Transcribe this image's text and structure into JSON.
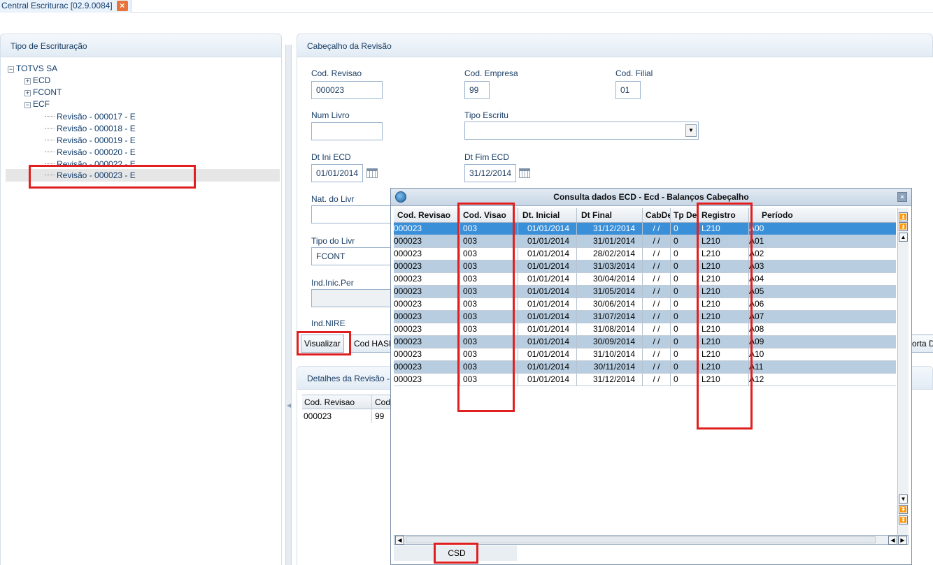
{
  "tab": {
    "title": "Central Escriturac [02.9.0084]",
    "close": "×"
  },
  "left_panel": {
    "title": "Tipo de Escrituração",
    "tree": {
      "root": "TOTVS SA",
      "ecd": "ECD",
      "fcont": "FCONT",
      "ecf": "ECF",
      "revisions": [
        "Revisão - 000017 - E",
        "Revisão - 000018 - E",
        "Revisão - 000019 - E",
        "Revisão - 000020 - E",
        "Revisão - 000022 - E",
        "Revisão - 000023 - E"
      ]
    }
  },
  "header_panel": {
    "title": "Cabeçalho da Revisão",
    "cod_revisao": {
      "label": "Cod. Revisao",
      "value": "000023"
    },
    "cod_empresa": {
      "label": "Cod. Empresa",
      "value": "99"
    },
    "cod_filial": {
      "label": "Cod. Filial",
      "value": "01"
    },
    "num_livro": {
      "label": "Num Livro",
      "value": ""
    },
    "tipo_escritu": {
      "label": "Tipo Escritu",
      "value": ""
    },
    "dt_ini": {
      "label": "Dt Ini ECD",
      "value": "01/01/2014"
    },
    "dt_fim": {
      "label": "Dt Fim ECD",
      "value": "31/12/2014"
    },
    "nat_livro": {
      "label": "Nat. do Livr",
      "value": ""
    },
    "tipo_livro": {
      "label": "Tipo do Livr",
      "value": "FCONT"
    },
    "ind_inic": {
      "label": "Ind.Inic.Per",
      "value": ""
    },
    "ind_nire": {
      "label": "Ind.NIRE"
    },
    "visualizar": "Visualizar",
    "cod_hash": "Cod HASH",
    "porta": "orta D"
  },
  "details_panel": {
    "title": "Detalhes da Revisão -",
    "columns": [
      "Cod. Revisao",
      "Cod"
    ],
    "rows": [
      [
        "000023",
        "99"
      ]
    ]
  },
  "dialog": {
    "title": "Consulta dados ECD - Ecd - Balanços Cabeçalho",
    "close": "×",
    "columns": [
      "Cod. Revisao",
      "Cod. Visao",
      "Dt. Inicial",
      "Dt Final",
      "CabDe",
      "Tp De",
      "Registro",
      "Período"
    ],
    "rows": [
      [
        "000023",
        "003",
        "01/01/2014",
        "31/12/2014",
        "/ /",
        "0",
        "L210",
        "A00"
      ],
      [
        "000023",
        "003",
        "01/01/2014",
        "31/01/2014",
        "/ /",
        "0",
        "L210",
        "A01"
      ],
      [
        "000023",
        "003",
        "01/01/2014",
        "28/02/2014",
        "/ /",
        "0",
        "L210",
        "A02"
      ],
      [
        "000023",
        "003",
        "01/01/2014",
        "31/03/2014",
        "/ /",
        "0",
        "L210",
        "A03"
      ],
      [
        "000023",
        "003",
        "01/01/2014",
        "30/04/2014",
        "/ /",
        "0",
        "L210",
        "A04"
      ],
      [
        "000023",
        "003",
        "01/01/2014",
        "31/05/2014",
        "/ /",
        "0",
        "L210",
        "A05"
      ],
      [
        "000023",
        "003",
        "01/01/2014",
        "30/06/2014",
        "/ /",
        "0",
        "L210",
        "A06"
      ],
      [
        "000023",
        "003",
        "01/01/2014",
        "31/07/2014",
        "/ /",
        "0",
        "L210",
        "A07"
      ],
      [
        "000023",
        "003",
        "01/01/2014",
        "31/08/2014",
        "/ /",
        "0",
        "L210",
        "A08"
      ],
      [
        "000023",
        "003",
        "01/01/2014",
        "30/09/2014",
        "/ /",
        "0",
        "L210",
        "A09"
      ],
      [
        "000023",
        "003",
        "01/01/2014",
        "31/10/2014",
        "/ /",
        "0",
        "L210",
        "A10"
      ],
      [
        "000023",
        "003",
        "01/01/2014",
        "30/11/2014",
        "/ /",
        "0",
        "L210",
        "A11"
      ],
      [
        "000023",
        "003",
        "01/01/2014",
        "31/12/2014",
        "/ /",
        "0",
        "L210",
        "A12"
      ]
    ],
    "selected_row": 0,
    "footer_label": "CSD"
  },
  "colors": {
    "highlight": "#e02020",
    "selected_row": "#3a8fd9",
    "alt_row": "#b8cde0",
    "tab_close": "#e8743b"
  },
  "icons": [
    "close-icon",
    "expand-icon",
    "collapse-icon",
    "calendar-icon",
    "chevron-down-icon",
    "app-logo-icon",
    "scroll-up-icon",
    "scroll-down-icon",
    "scroll-left-icon",
    "scroll-right-icon"
  ]
}
